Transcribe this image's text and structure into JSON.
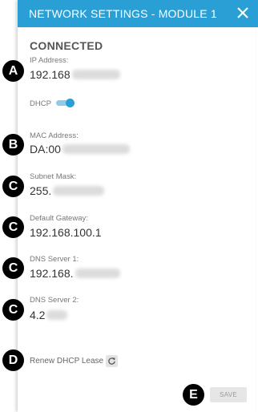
{
  "header": {
    "title": "NETWORK SETTINGS - MODULE 1",
    "background": "#2a9fd6"
  },
  "status": "CONNECTED",
  "fields": {
    "ip": {
      "label": "IP Address:",
      "value": "192.168"
    },
    "dhcp": {
      "label": "DHCP",
      "enabled": true
    },
    "mac": {
      "label": "MAC Address:",
      "value": "DA:00"
    },
    "subnet": {
      "label": "Subnet Mask:",
      "value": "255."
    },
    "gateway": {
      "label": "Default Gateway:",
      "value": "192.168.100.1"
    },
    "dns1": {
      "label": "DNS Server 1:",
      "value": "192.168."
    },
    "dns2": {
      "label": "DNS Server 2:",
      "value": "4.2"
    }
  },
  "renew": {
    "label": "Renew DHCP Lease",
    "icon": "refresh-icon"
  },
  "save_label": "SAVE",
  "markers": [
    "A",
    "B",
    "C",
    "C",
    "C",
    "C",
    "D",
    "E"
  ]
}
